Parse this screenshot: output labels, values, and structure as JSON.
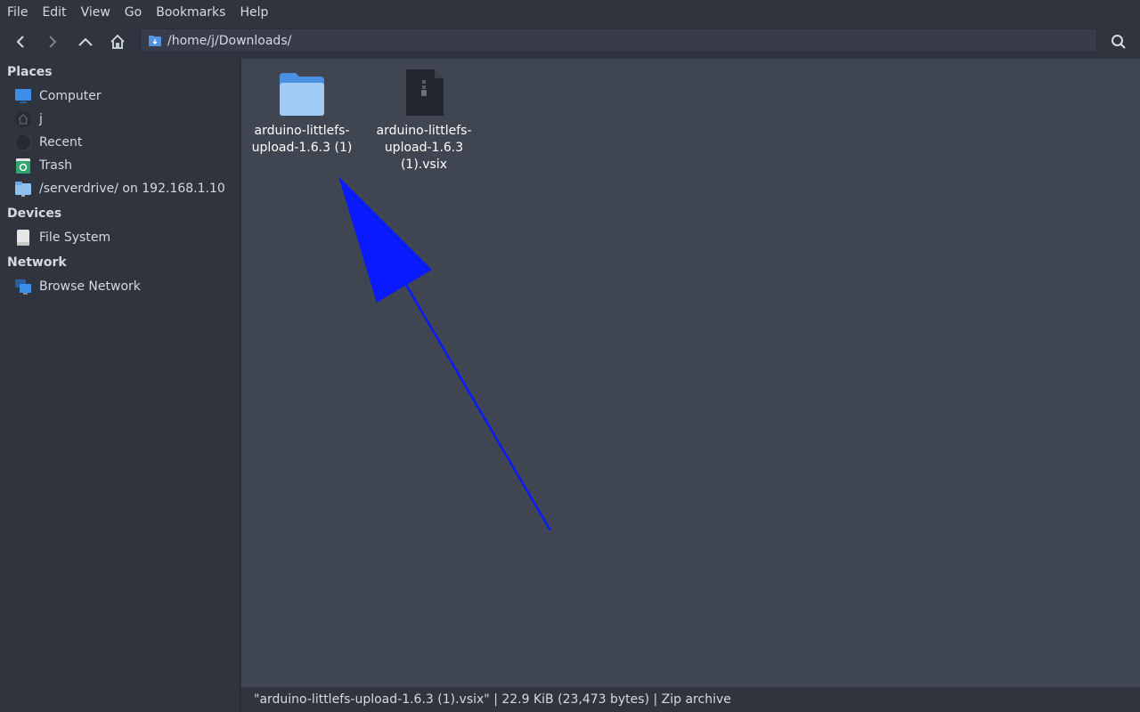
{
  "menubar": {
    "items": [
      "File",
      "Edit",
      "View",
      "Go",
      "Bookmarks",
      "Help"
    ]
  },
  "toolbar": {
    "path": "/home/j/Downloads/",
    "icons": [
      "back-icon",
      "forward-icon",
      "up-icon",
      "home-icon",
      "search-icon"
    ]
  },
  "sidebar": {
    "places_title": "Places",
    "places": [
      {
        "label": "Computer",
        "icon": "computer-icon"
      },
      {
        "label": "j",
        "icon": "home-folder-icon"
      },
      {
        "label": "Recent",
        "icon": "recent-icon"
      },
      {
        "label": "Trash",
        "icon": "trash-icon"
      },
      {
        "label": "/serverdrive/ on 192.168.1.10",
        "icon": "network-folder-icon"
      }
    ],
    "devices_title": "Devices",
    "devices": [
      {
        "label": "File System",
        "icon": "drive-icon"
      }
    ],
    "network_title": "Network",
    "network": [
      {
        "label": "Browse Network",
        "icon": "network-icon"
      }
    ]
  },
  "files": [
    {
      "line1": "arduino-littlefs-",
      "line2": "upload-1.6.3 (1)",
      "icon": "folder-icon",
      "selected": false
    },
    {
      "line1": "arduino-littlefs-",
      "line2": "upload-1.6.3 (1).vsix",
      "icon": "zip-file-icon",
      "selected": true
    }
  ],
  "status": {
    "text": "\"arduino-littlefs-upload-1.6.3 (1).vsix\"  |  22.9 KiB (23,473 bytes)  |  Zip archive"
  },
  "colors": {
    "background": "#2f343f",
    "content": "#404552",
    "accent": "#5294e2",
    "annotation_arrow": "#0a1aff"
  }
}
